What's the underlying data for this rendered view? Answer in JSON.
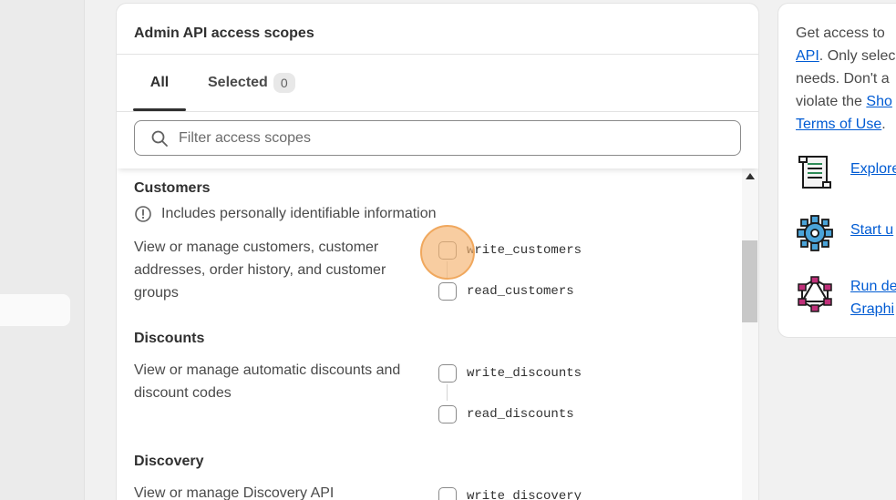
{
  "card": {
    "title": "Admin API access scopes",
    "tabs": {
      "all_label": "All",
      "selected_label": "Selected",
      "selected_count": "0"
    },
    "search": {
      "placeholder": "Filter access scopes",
      "value": ""
    }
  },
  "sections": {
    "customers": {
      "title": "Customers",
      "pii_note": "Includes personally identifiable information",
      "description": "View or manage customers, customer addresses, order history, and customer groups",
      "scopes": [
        "write_customers",
        "read_customers"
      ]
    },
    "discounts": {
      "title": "Discounts",
      "description": "View or manage automatic discounts and discount codes",
      "scopes": [
        "write_discounts",
        "read_discounts"
      ]
    },
    "discovery": {
      "title": "Discovery",
      "description": "View or manage Discovery API",
      "scopes": [
        "write_discovery"
      ]
    }
  },
  "side": {
    "line1": "Get access to",
    "api_link": "API",
    "line2_rest": ". Only selec",
    "line3": "needs. Don't a",
    "line4_prefix": "violate the ",
    "line4_link": "Sho",
    "terms_link": "Terms of Use",
    "terms_suffix": ".",
    "resources": [
      {
        "label_lines": [
          "Explore"
        ],
        "icon": "scroll-icon"
      },
      {
        "label_lines": [
          "Start u"
        ],
        "icon": "gear-icon"
      },
      {
        "label_lines": [
          "Run de",
          "Graphi"
        ],
        "icon": "graphql-icon"
      }
    ]
  },
  "colors": {
    "link": "#005bd3",
    "highlight": "#f5b26e"
  }
}
